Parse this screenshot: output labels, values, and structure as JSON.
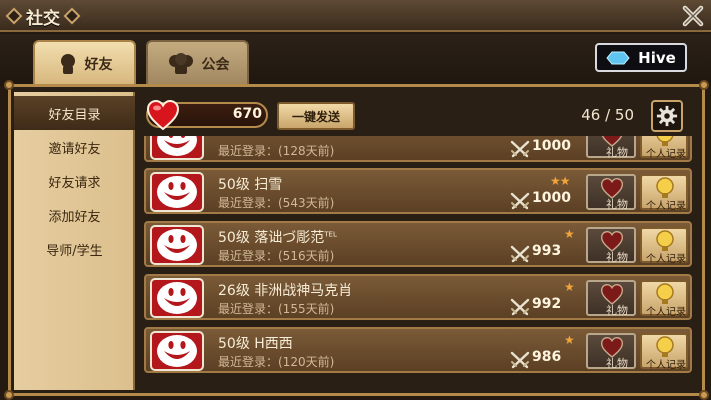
{
  "window": {
    "title": "社交"
  },
  "tabs": [
    {
      "label": "好友",
      "active": true
    },
    {
      "label": "公会",
      "active": false
    }
  ],
  "hive_button": {
    "label": "Hive"
  },
  "sidebar": {
    "items": [
      {
        "label": "好友目录",
        "active": true
      },
      {
        "label": "邀请好友",
        "active": false
      },
      {
        "label": "好友请求",
        "active": false
      },
      {
        "label": "添加好友",
        "active": false
      },
      {
        "label": "导师/学生",
        "active": false
      }
    ]
  },
  "toolbar": {
    "hearts": "670",
    "send_all_label": "一键发送",
    "friend_count": "46 / 50"
  },
  "friends": [
    {
      "name": "",
      "level": "",
      "last_login": "最近登录：(128天前)",
      "stars": 0,
      "score": "1000",
      "gift_label": "礼物",
      "record_label": "个人记录"
    },
    {
      "name": "扫雪",
      "level": "50级",
      "last_login": "最近登录：(543天前)",
      "stars": 2,
      "score": "1000",
      "gift_label": "礼物",
      "record_label": "个人记录"
    },
    {
      "name": "落诎づ彫范",
      "name_suffix": "TEL",
      "level": "50级",
      "last_login": "最近登录：(516天前)",
      "stars": 1,
      "score": "993",
      "gift_label": "礼物",
      "record_label": "个人记录"
    },
    {
      "name": "非洲战神马克肖",
      "level": "26级",
      "last_login": "最近登录：(155天前)",
      "stars": 1,
      "score": "992",
      "gift_label": "礼物",
      "record_label": "个人记录"
    },
    {
      "name": "H西西",
      "level": "50级",
      "last_login": "最近登录：(120天前)",
      "stars": 1,
      "score": "986",
      "gift_label": "礼物",
      "record_label": "个人记录"
    }
  ],
  "colors": {
    "accent_gold": "#c9a36a",
    "avatar_red": "#b3161b",
    "star_orange": "#f0a43a"
  },
  "icons": {
    "close": "close-x-icon",
    "settings": "gear-icon",
    "hearts": "heart-icon",
    "score": "crossed-swords-icon",
    "gift": "heart-icon",
    "record": "bulb-icon",
    "avatar": "smiley-face-icon",
    "hive": "hive-diamond-icon"
  }
}
